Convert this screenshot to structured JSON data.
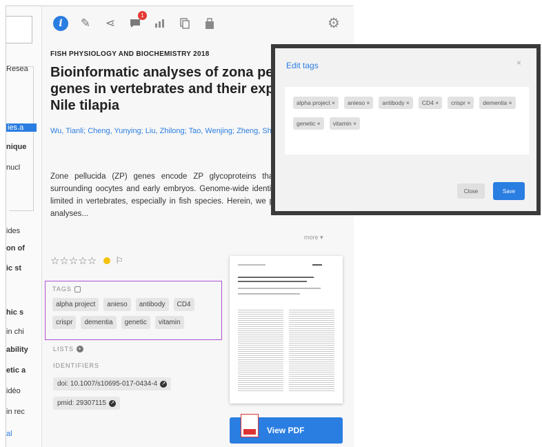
{
  "toolbar": {
    "icons": [
      "info-icon",
      "edit-icon",
      "share-icon",
      "comments-icon",
      "chart-icon",
      "copy-icon",
      "bag-icon"
    ],
    "comments_badge": "1",
    "settings_icon": "gear-icon"
  },
  "article": {
    "journal": "FISH PHYSIOLOGY AND BIOCHEMISTRY 2018",
    "title": "Bioinformatic analyses of zona pellucida genes in vertebrates and their expression in Nile tilapia",
    "authors": "Wu, Tianli; Cheng, Yunying; Liu, Zhilong; Tao, Wenjing; Zheng, Shuqing",
    "abstract": "Zone pellucida (ZP) genes encode ZP glycoproteins that constitute the coat surrounding oocytes and early embryos. Genome-wide identification of ZP genes is limited in vertebrates, especially in fish species. Herein, we performed bioinformatic analyses...",
    "more_label": "more",
    "stars": "☆☆☆☆☆"
  },
  "tags_section": {
    "label": "TAGS",
    "items": [
      "alpha project",
      "anieso",
      "antibody",
      "CD4",
      "crispr",
      "dementia",
      "genetic",
      "vitamin"
    ]
  },
  "lists_label": "LISTS",
  "identifiers": {
    "label": "IDENTIFIERS",
    "doi": "doi: 10.1007/s10695-017-0434-4",
    "pmid": "pmid: 29307115"
  },
  "view_pdf_label": "View PDF",
  "dialog": {
    "title": "Edit tags",
    "close_x": "×",
    "tags": [
      "alpha project ×",
      "anieso ×",
      "antibody ×",
      "CD4 ×",
      "crispr ×",
      "dementia ×",
      "genetic ×",
      "vitamin ×"
    ],
    "close_label": "Close",
    "save_label": "Save"
  },
  "left_strip": {
    "lines": [
      "Resea",
      "ies.a",
      "nique",
      "nucl",
      "ides",
      "on of",
      "ic st",
      "hic s",
      "in chi",
      "ability",
      "etic a",
      "idéo",
      "in rec",
      "al"
    ]
  }
}
